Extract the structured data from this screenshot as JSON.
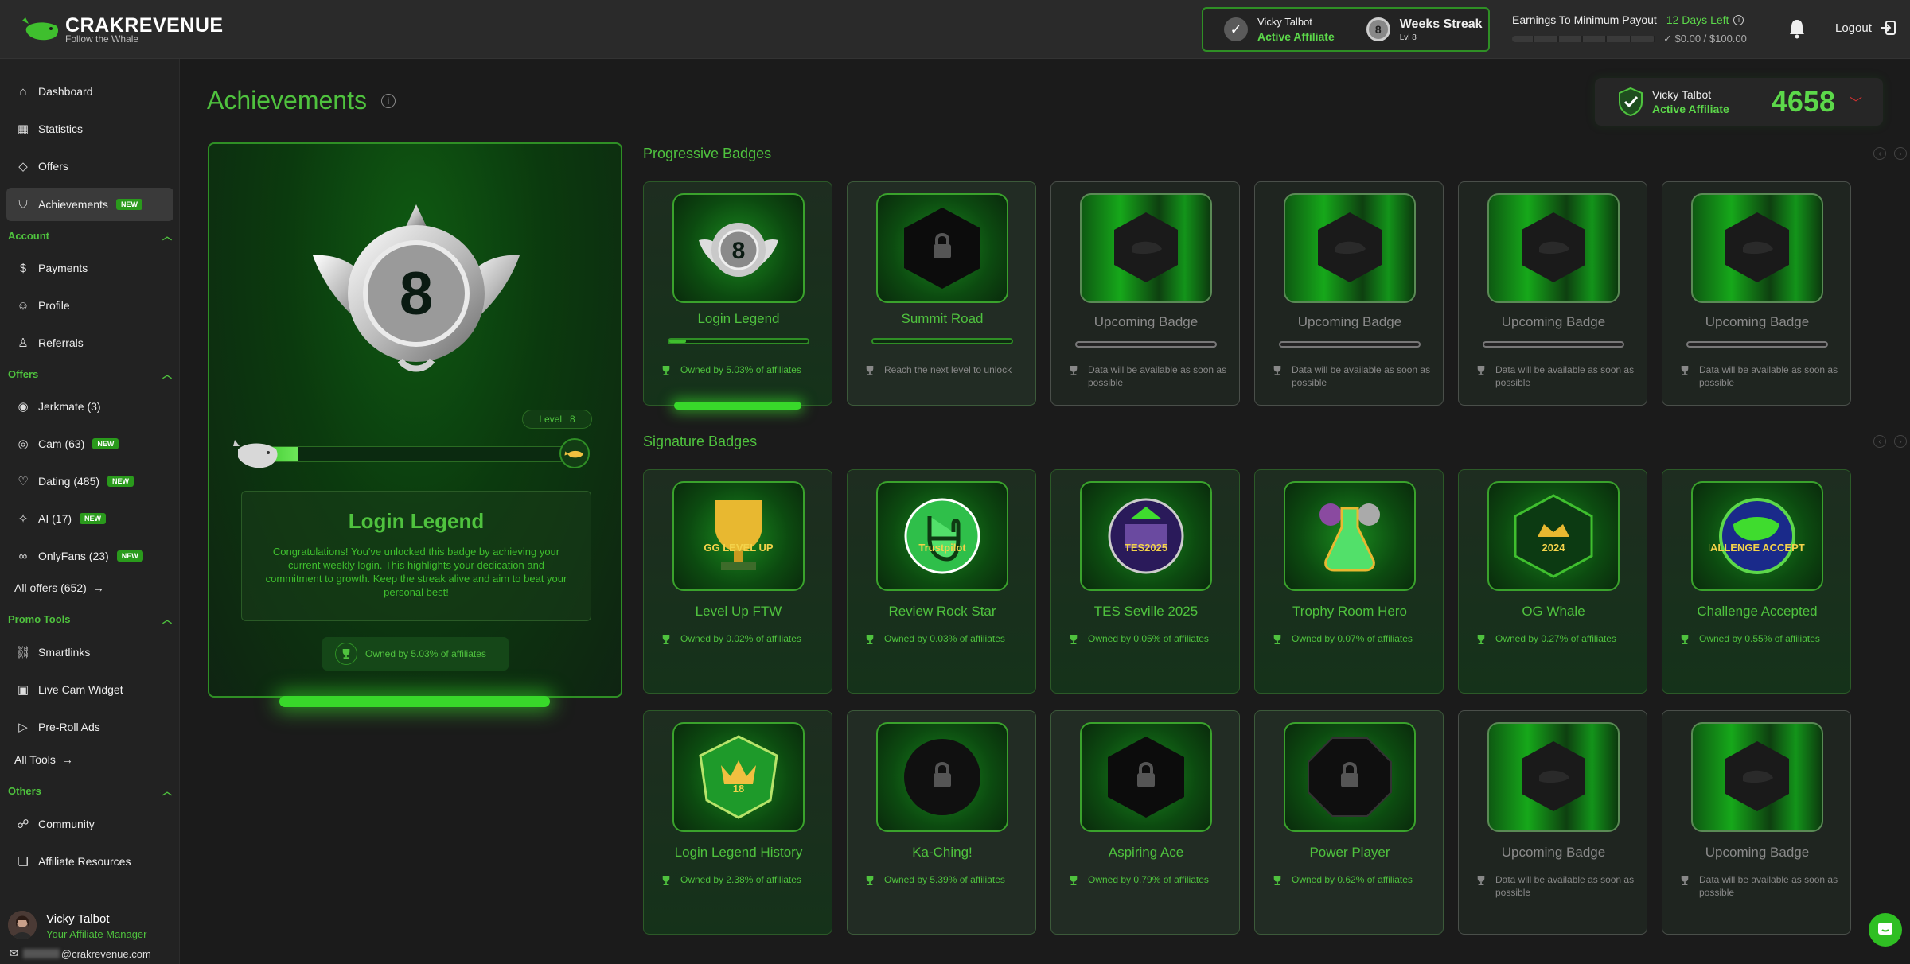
{
  "brand": {
    "name_bold": "CRAK",
    "name_rest": "REVENUE",
    "tagline": "Follow the Whale"
  },
  "topbar": {
    "user_name": "Vicky Talbot",
    "user_role": "Active Affiliate",
    "streak_number": "8",
    "streak_title": "Weeks Streak",
    "streak_level": "Lvl 8",
    "payout_label": "Earnings To Minimum Payout",
    "payout_days": "12 Days Left",
    "payout_value": "$0.00 / $100.00",
    "logout": "Logout"
  },
  "sidebar": {
    "dashboard": "Dashboard",
    "statistics": "Statistics",
    "offers_link": "Offers",
    "achievements": "Achievements",
    "new_label": "NEW",
    "account_head": "Account",
    "payments": "Payments",
    "profile": "Profile",
    "referrals": "Referrals",
    "offers_head": "Offers",
    "jerkmate": "Jerkmate (3)",
    "cam": "Cam (63)",
    "dating": "Dating (485)",
    "ai": "AI (17)",
    "onlyfans": "OnlyFans (23)",
    "all_offers": "All offers (652)",
    "promo_head": "Promo Tools",
    "smartlinks": "Smartlinks",
    "live_cam": "Live Cam Widget",
    "preroll": "Pre-Roll Ads",
    "all_tools": "All Tools",
    "others_head": "Others",
    "community": "Community",
    "affiliate_resources": "Affiliate Resources",
    "manager_name": "Vicky Talbot",
    "manager_role": "Your Affiliate Manager",
    "manager_email_suffix": "@crakrevenue.com"
  },
  "main": {
    "title": "Achievements",
    "score_user": "Vicky Talbot",
    "score_role": "Active Affiliate",
    "score": "4658",
    "feature": {
      "level_label": "Level",
      "level_value": "8",
      "progress": 0.15,
      "medal_number": "8",
      "title": "Login Legend",
      "description": "Congratulations! You've unlocked this badge by achieving your current weekly login. This highlights your dedication and commitment to growth. Keep the streak alive and aim to beat your personal best!",
      "owned": "Owned by 5.03% of affiliates"
    },
    "progressive_title": "Progressive Badges",
    "signature_title": "Signature Badges",
    "progressive": [
      {
        "name": "Login Legend",
        "foot": "Owned by 5.03% of affiliates",
        "progress": 0.12
      },
      {
        "name": "Summit Road",
        "foot": "Reach the next level to unlock",
        "progress": 0.0
      },
      {
        "name": "Upcoming Badge",
        "foot": "Data will be available as soon as possible"
      },
      {
        "name": "Upcoming Badge",
        "foot": "Data will be available as soon as possible"
      },
      {
        "name": "Upcoming Badge",
        "foot": "Data will be available as soon as possible"
      },
      {
        "name": "Upcoming Badge",
        "foot": "Data will be available as soon as possible"
      }
    ],
    "signature_row1": [
      {
        "name": "Level Up FTW",
        "foot": "Owned by 0.02% of affiliates",
        "art": "GG LEVEL UP"
      },
      {
        "name": "Review Rock Star",
        "foot": "Owned by 0.03% of affiliates",
        "art": "Trustpilot"
      },
      {
        "name": "TES Seville 2025",
        "foot": "Owned by 0.05% of affiliates",
        "art": "TES2025"
      },
      {
        "name": "Trophy Room Hero",
        "foot": "Owned by 0.07% of affiliates"
      },
      {
        "name": "OG Whale",
        "foot": "Owned by 0.27% of affiliates",
        "art": "2024"
      },
      {
        "name": "Challenge Accepted",
        "foot": "Owned by 0.55% of affiliates",
        "art": "CHALLENGE ACCEPTED"
      }
    ],
    "signature_row2": [
      {
        "name": "Login Legend History",
        "foot": "Owned by 2.38% of affiliates",
        "art": "18"
      },
      {
        "name": "Ka-Ching!",
        "foot": "Owned by 5.39% of affiliates"
      },
      {
        "name": "Aspiring Ace",
        "foot": "Owned by 0.79% of affiliates"
      },
      {
        "name": "Power Player",
        "foot": "Owned by 0.62% of affiliates"
      },
      {
        "name": "Upcoming Badge",
        "foot": "Data will be available as soon as possible"
      },
      {
        "name": "Upcoming Badge",
        "foot": "Data will be available as soon as possible"
      }
    ]
  },
  "colors": {
    "accent": "#4fc23e",
    "bg": "#1b1b1b",
    "danger": "#d03030"
  }
}
